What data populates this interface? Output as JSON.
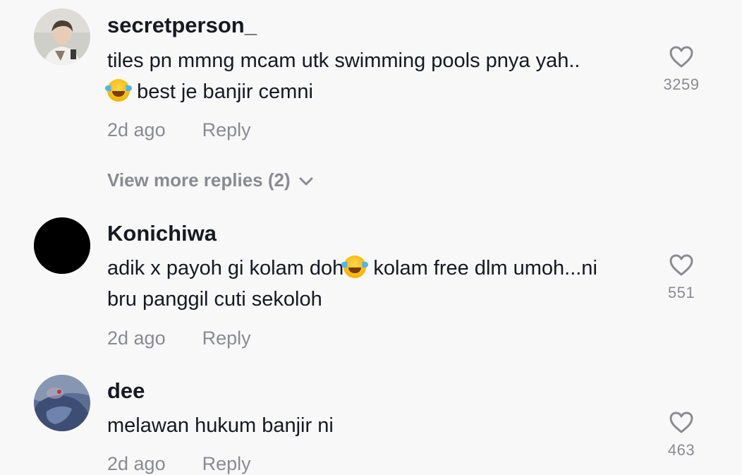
{
  "comments": [
    {
      "username": "secretperson_",
      "line1": "tiles pn mmng mcam utk swimming pools pnya yah..",
      "line2": "best je banjir cemni",
      "time": "2d ago",
      "reply": "Reply",
      "likes": "3259",
      "more_replies": "View more replies (2)",
      "avatar_icon": "person-photo-avatar"
    },
    {
      "username": "Konichiwa",
      "line1_before": "adik x payoh gi kolam doh",
      "line1_after": " kolam free dlm umoh...ni",
      "line2": "bru panggil cuti sekoloh",
      "time": "2d ago",
      "reply": "Reply",
      "likes": "551",
      "avatar_icon": "black-circle-avatar"
    },
    {
      "username": "dee",
      "line1": "melawan hukum banjir ni",
      "time": "2d ago",
      "reply": "Reply",
      "likes": "463",
      "avatar_icon": "blue-photo-avatar"
    }
  ],
  "emoji": "face-with-tears-of-joy",
  "colors": {
    "background": "#f8f8f8",
    "text": "#161823",
    "muted": "#8a8b91"
  }
}
